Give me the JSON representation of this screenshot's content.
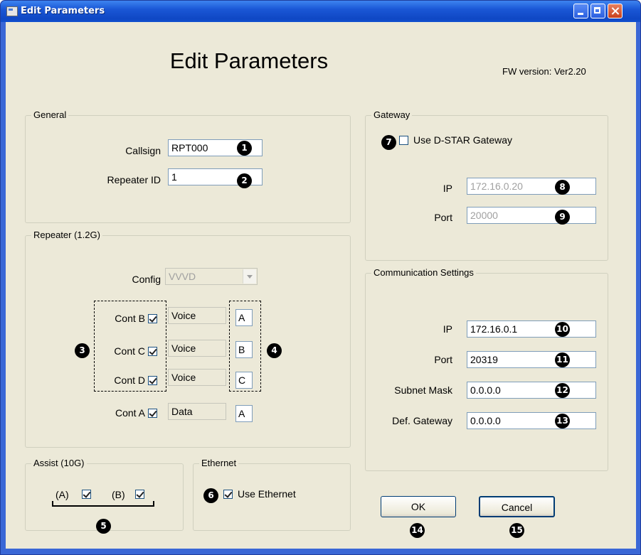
{
  "window": {
    "title": "Edit Parameters"
  },
  "header": {
    "title": "Edit Parameters",
    "fw_version": "FW version: Ver2.20"
  },
  "general": {
    "group_label": "General",
    "callsign_label": "Callsign",
    "callsign_value": "RPT000",
    "repeater_id_label": "Repeater ID",
    "repeater_id_value": "1"
  },
  "repeater": {
    "group_label": "Repeater (1.2G)",
    "config_label": "Config",
    "config_value": "VVVD",
    "rows": [
      {
        "label": "Cont B",
        "checked": true,
        "mode": "Voice",
        "letter": "A"
      },
      {
        "label": "Cont C",
        "checked": true,
        "mode": "Voice",
        "letter": "B"
      },
      {
        "label": "Cont D",
        "checked": true,
        "mode": "Voice",
        "letter": "C"
      },
      {
        "label": "Cont A",
        "checked": true,
        "mode": "Data",
        "letter": "A"
      }
    ]
  },
  "assist": {
    "group_label": "Assist (10G)",
    "a_label": "(A)",
    "a_checked": true,
    "b_label": "(B)",
    "b_checked": true
  },
  "ethernet": {
    "group_label": "Ethernet",
    "use_label": "Use Ethernet",
    "checked": true
  },
  "gateway": {
    "group_label": "Gateway",
    "use_label": "Use D-STAR Gateway",
    "checked": false,
    "ip_label": "IP",
    "ip_value": "172.16.0.20",
    "port_label": "Port",
    "port_value": "20000"
  },
  "comm": {
    "group_label": "Communication Settings",
    "ip_label": "IP",
    "ip_value": "172.16.0.1",
    "port_label": "Port",
    "port_value": "20319",
    "subnet_label": "Subnet Mask",
    "subnet_value": "0.0.0.0",
    "gateway_label": "Def. Gateway",
    "gateway_value": "0.0.0.0"
  },
  "buttons": {
    "ok": "OK",
    "cancel": "Cancel"
  },
  "callouts": [
    "1",
    "2",
    "3",
    "4",
    "5",
    "6",
    "7",
    "8",
    "9",
    "10",
    "11",
    "12",
    "13",
    "14",
    "15"
  ]
}
